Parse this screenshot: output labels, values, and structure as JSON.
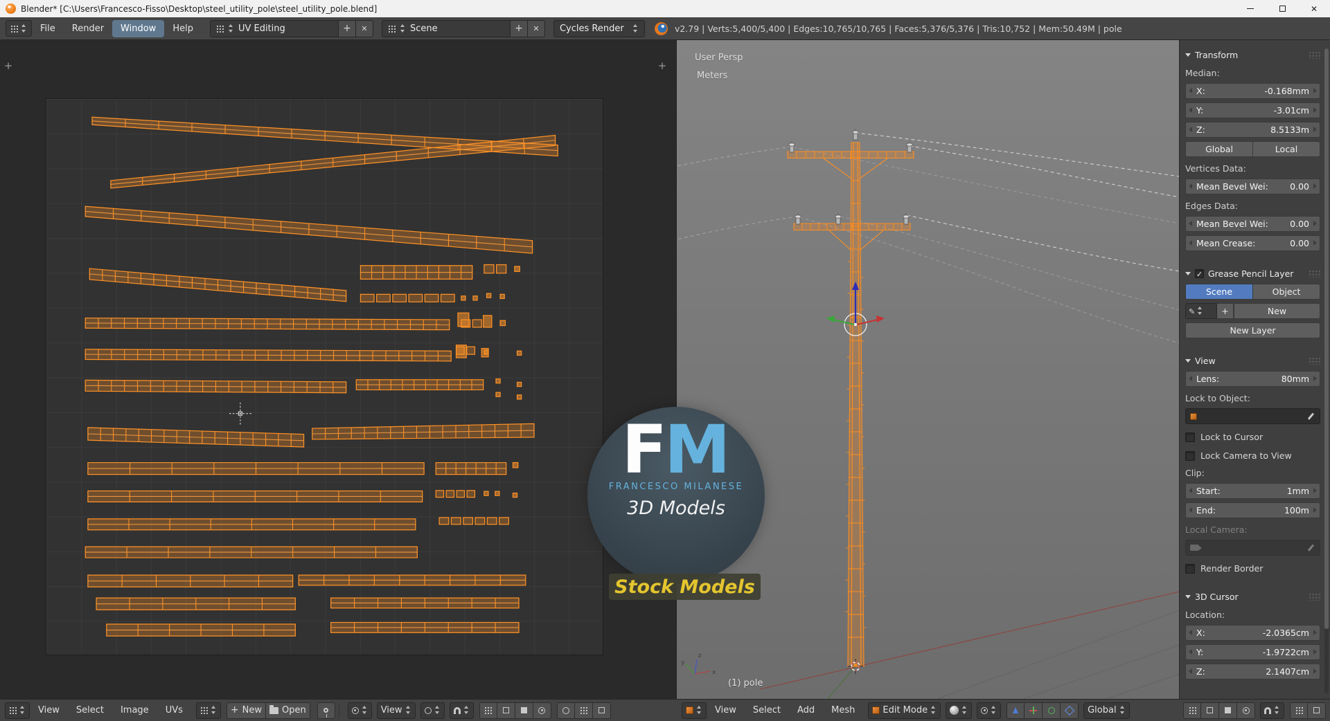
{
  "window_title": "Blender* [C:\\Users\\Francesco-Fisso\\Desktop\\steel_utility_pole\\steel_utility_pole.blend]",
  "topbar": {
    "menus": [
      "File",
      "Render",
      "Window",
      "Help"
    ],
    "layout": "UV Editing",
    "scene": "Scene",
    "engine": "Cycles Render",
    "stats": "v2.79 | Verts:5,400/5,400 | Edges:10,765/10,765 | Faces:5,376/5,376 | Tris:10,752 | Mem:50.49M | pole"
  },
  "uv_editor": {
    "menus": [
      "View",
      "Select",
      "Image",
      "UVs"
    ],
    "new_button": "New",
    "open_button": "Open",
    "view_dropdown": "View"
  },
  "viewport": {
    "persp_label": "User Persp",
    "units_label": "Meters",
    "object_label": "(1) pole",
    "menus": [
      "View",
      "Select",
      "Add",
      "Mesh"
    ],
    "mode": "Edit Mode",
    "orientation": "Global"
  },
  "npanel": {
    "transform": {
      "title": "Transform",
      "median_label": "Median:",
      "median": [
        {
          "l": "X:",
          "v": "-0.168mm"
        },
        {
          "l": "Y:",
          "v": "-3.01cm"
        },
        {
          "l": "Z:",
          "v": "8.5133m"
        }
      ],
      "global_button": "Global",
      "local_button": "Local",
      "vertices_label": "Vertices Data:",
      "vert_bevel": {
        "l": "Mean Bevel Wei:",
        "v": "0.00"
      },
      "edges_label": "Edges Data:",
      "edge_bevel": {
        "l": "Mean Bevel Wei:",
        "v": "0.00"
      },
      "crease": {
        "l": "Mean Crease:",
        "v": "0.00"
      }
    },
    "gpencil": {
      "title": "Grease Pencil Layer",
      "scene_tab": "Scene",
      "object_tab": "Object",
      "new_button": "New",
      "new_layer_button": "New Layer"
    },
    "view": {
      "title": "View",
      "lens": {
        "l": "Lens:",
        "v": "80mm"
      },
      "lock_object_label": "Lock to Object:",
      "lock_cursor": "Lock to Cursor",
      "lock_camera": "Lock Camera to View",
      "clip_label": "Clip:",
      "clip_start": {
        "l": "Start:",
        "v": "1mm"
      },
      "clip_end": {
        "l": "End:",
        "v": "100m"
      },
      "local_camera_label": "Local Camera:",
      "render_border": "Render Border"
    },
    "cursor3d": {
      "title": "3D Cursor",
      "location_label": "Location:",
      "location": [
        {
          "l": "X:",
          "v": "-2.0365cm"
        },
        {
          "l": "Y:",
          "v": "-1.9722cm"
        },
        {
          "l": "Z:",
          "v": "2.1407cm"
        }
      ]
    }
  },
  "watermark": {
    "f": "F",
    "m": "M",
    "name": "FRANCESCO MILANESE",
    "sub": "3D Models",
    "stock": "Stock Models"
  },
  "colors": {
    "selection_orange": "#ff9226",
    "blender_blue": "#527cbf",
    "viewport_gray": "#7a7a7a"
  },
  "uv_islands": {
    "strips": [
      [
        54,
        26,
        604,
        61,
        9,
        13,
        14
      ],
      [
        76,
        101,
        601,
        49,
        9,
        12,
        14
      ],
      [
        46,
        133,
        574,
        175,
        12,
        15,
        16
      ],
      [
        51,
        207,
        354,
        233,
        13,
        13,
        20
      ],
      [
        371,
        205,
        503,
        205,
        16,
        16,
        10
      ],
      [
        46,
        265,
        476,
        267,
        12,
        12,
        28
      ],
      [
        46,
        302,
        478,
        304,
        12,
        12,
        28
      ],
      [
        46,
        339,
        354,
        341,
        13,
        13,
        20
      ],
      [
        366,
        338,
        516,
        338,
        12,
        12,
        11
      ],
      [
        49,
        396,
        304,
        404,
        15,
        15,
        17
      ],
      [
        314,
        396,
        576,
        392,
        13,
        16,
        17
      ],
      [
        49,
        437,
        446,
        437,
        14,
        14,
        8
      ],
      [
        460,
        437,
        543,
        437,
        14,
        14,
        7
      ],
      [
        49,
        470,
        444,
        470,
        13,
        13,
        8
      ],
      [
        49,
        503,
        436,
        503,
        13,
        13,
        8
      ],
      [
        46,
        536,
        438,
        536,
        13,
        13,
        8
      ],
      [
        49,
        570,
        291,
        570,
        14,
        14,
        6
      ],
      [
        298,
        569,
        566,
        569,
        12,
        12,
        9
      ],
      [
        59,
        597,
        294,
        597,
        14,
        14,
        6
      ],
      [
        336,
        596,
        558,
        596,
        12,
        12,
        8
      ],
      [
        71,
        628,
        294,
        628,
        14,
        14,
        6
      ],
      [
        336,
        625,
        558,
        625,
        12,
        12,
        8
      ]
    ],
    "dashrows": [
      [
        371,
        231,
        111,
        9,
        6
      ],
      [
        517,
        196,
        26,
        10,
        2
      ],
      [
        490,
        261,
        24,
        9,
        2
      ],
      [
        484,
        293,
        22,
        9,
        2
      ],
      [
        460,
        463,
        46,
        8,
        4
      ],
      [
        464,
        495,
        82,
        8,
        6
      ]
    ],
    "bits": [
      [
        553,
        198,
        6,
        6
      ],
      [
        520,
        230,
        5,
        5
      ],
      [
        536,
        231,
        5,
        5
      ],
      [
        536,
        262,
        6,
        6
      ],
      [
        486,
        253,
        13,
        16
      ],
      [
        516,
        256,
        10,
        14
      ],
      [
        484,
        291,
        12,
        15
      ],
      [
        514,
        295,
        8,
        10
      ],
      [
        556,
        298,
        5,
        5
      ],
      [
        517,
        297,
        5,
        5
      ],
      [
        531,
        331,
        5,
        5
      ],
      [
        556,
        335,
        5,
        5
      ],
      [
        531,
        347,
        5,
        5
      ],
      [
        556,
        350,
        5,
        5
      ],
      [
        551,
        430,
        6,
        6
      ],
      [
        517,
        464,
        5,
        5
      ],
      [
        530,
        464,
        5,
        5
      ],
      [
        551,
        466,
        5,
        5
      ],
      [
        490,
        233,
        5,
        5
      ],
      [
        504,
        233,
        5,
        5
      ]
    ],
    "cursor": [
      229,
      372
    ]
  }
}
